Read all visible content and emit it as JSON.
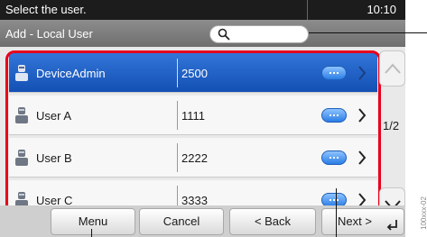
{
  "status": {
    "message": "Select the user.",
    "time": "10:10"
  },
  "title": {
    "text": "Add - Local User"
  },
  "search": {
    "placeholder": ""
  },
  "users": [
    {
      "name": "DeviceAdmin",
      "number": "2500",
      "selected": true
    },
    {
      "name": "User A",
      "number": "1111",
      "selected": false
    },
    {
      "name": "User B",
      "number": "2222",
      "selected": false
    },
    {
      "name": "User C",
      "number": "3333",
      "selected": false
    }
  ],
  "pager": {
    "label": "1/2"
  },
  "buttons": {
    "menu": "Menu",
    "cancel": "Cancel",
    "back": "< Back",
    "next": "Next >"
  },
  "side_label": "100xxx-02",
  "colors": {
    "highlight": "#e8001c",
    "selected_row": "#1f5fc9"
  }
}
